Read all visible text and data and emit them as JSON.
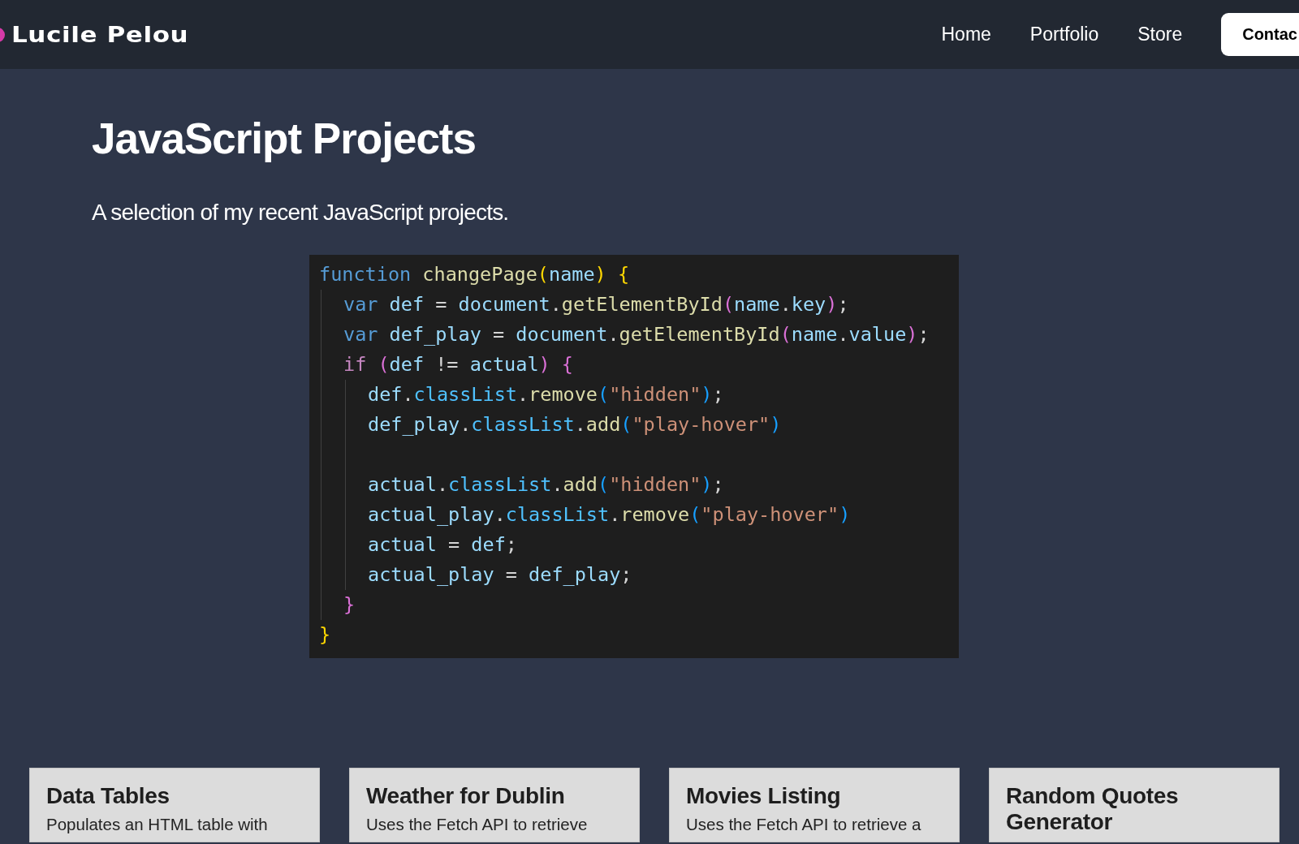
{
  "header": {
    "logo": "Lucile Pelou",
    "nav": [
      {
        "label": "Home",
        "kind": "link"
      },
      {
        "label": "Portfolio",
        "kind": "link"
      },
      {
        "label": "Store",
        "kind": "link"
      },
      {
        "label": "Contac",
        "kind": "button"
      }
    ]
  },
  "title": "JavaScript Projects",
  "subtitle": "A selection of my recent JavaScript projects.",
  "code": {
    "lines": [
      {
        "tokens": [
          {
            "text": "function ",
            "kind": "keyword"
          },
          {
            "text": "changePage",
            "kind": "function"
          },
          {
            "text": "(",
            "kind": "bracket1"
          },
          {
            "text": "name",
            "kind": "variable"
          },
          {
            "text": ")",
            "kind": "bracket1"
          },
          {
            "text": " {",
            "kind": "bracket1"
          }
        ],
        "children": [
          {
            "tokens": [
              {
                "text": "var ",
                "kind": "keyword"
              },
              {
                "text": "def",
                "kind": "variable"
              },
              {
                "text": " = ",
                "kind": "plain"
              },
              {
                "text": "document",
                "kind": "variable"
              },
              {
                "text": ".",
                "kind": "plain"
              },
              {
                "text": "getElementById",
                "kind": "function"
              },
              {
                "text": "(",
                "kind": "bracket2"
              },
              {
                "text": "name",
                "kind": "variable"
              },
              {
                "text": ".",
                "kind": "plain"
              },
              {
                "text": "key",
                "kind": "variable"
              },
              {
                "text": ")",
                "kind": "bracket2"
              },
              {
                "text": ";",
                "kind": "plain"
              }
            ]
          },
          {
            "tokens": [
              {
                "text": "var ",
                "kind": "keyword"
              },
              {
                "text": "def_play",
                "kind": "variable"
              },
              {
                "text": " = ",
                "kind": "plain"
              },
              {
                "text": "document",
                "kind": "variable"
              },
              {
                "text": ".",
                "kind": "plain"
              },
              {
                "text": "getElementById",
                "kind": "function"
              },
              {
                "text": "(",
                "kind": "bracket2"
              },
              {
                "text": "name",
                "kind": "variable"
              },
              {
                "text": ".",
                "kind": "plain"
              },
              {
                "text": "value",
                "kind": "variable"
              },
              {
                "text": ")",
                "kind": "bracket2"
              },
              {
                "text": ";",
                "kind": "plain"
              }
            ]
          },
          {
            "tokens": [
              {
                "text": "if ",
                "kind": "control"
              },
              {
                "text": "(",
                "kind": "bracket2"
              },
              {
                "text": "def",
                "kind": "variable"
              },
              {
                "text": " != ",
                "kind": "plain"
              },
              {
                "text": "actual",
                "kind": "variable"
              },
              {
                "text": ")",
                "kind": "bracket2"
              },
              {
                "text": " {",
                "kind": "bracket2"
              }
            ],
            "children": [
              {
                "kind": "code",
                "tokens": [
                  {
                    "text": "def",
                    "kind": "variable"
                  },
                  {
                    "text": ".",
                    "kind": "plain"
                  },
                  {
                    "text": "classList",
                    "kind": "property"
                  },
                  {
                    "text": ".",
                    "kind": "plain"
                  },
                  {
                    "text": "remove",
                    "kind": "function"
                  },
                  {
                    "text": "(",
                    "kind": "bracket3"
                  },
                  {
                    "text": "\"hidden\"",
                    "kind": "string"
                  },
                  {
                    "text": ")",
                    "kind": "bracket3"
                  },
                  {
                    "text": ";",
                    "kind": "plain"
                  }
                ]
              },
              {
                "kind": "code",
                "tokens": [
                  {
                    "text": "def_play",
                    "kind": "variable"
                  },
                  {
                    "text": ".",
                    "kind": "plain"
                  },
                  {
                    "text": "classList",
                    "kind": "property"
                  },
                  {
                    "text": ".",
                    "kind": "plain"
                  },
                  {
                    "text": "add",
                    "kind": "function"
                  },
                  {
                    "text": "(",
                    "kind": "bracket3"
                  },
                  {
                    "text": "\"play-hover\"",
                    "kind": "string"
                  },
                  {
                    "text": ")",
                    "kind": "bracket3"
                  }
                ]
              },
              {
                "kind": "blank"
              },
              {
                "kind": "code",
                "tokens": [
                  {
                    "text": "actual",
                    "kind": "variable"
                  },
                  {
                    "text": ".",
                    "kind": "plain"
                  },
                  {
                    "text": "classList",
                    "kind": "property"
                  },
                  {
                    "text": ".",
                    "kind": "plain"
                  },
                  {
                    "text": "add",
                    "kind": "function"
                  },
                  {
                    "text": "(",
                    "kind": "bracket3"
                  },
                  {
                    "text": "\"hidden\"",
                    "kind": "string"
                  },
                  {
                    "text": ")",
                    "kind": "bracket3"
                  },
                  {
                    "text": ";",
                    "kind": "plain"
                  }
                ]
              },
              {
                "kind": "code",
                "tokens": [
                  {
                    "text": "actual_play",
                    "kind": "variable"
                  },
                  {
                    "text": ".",
                    "kind": "plain"
                  },
                  {
                    "text": "classList",
                    "kind": "property"
                  },
                  {
                    "text": ".",
                    "kind": "plain"
                  },
                  {
                    "text": "remove",
                    "kind": "function"
                  },
                  {
                    "text": "(",
                    "kind": "bracket3"
                  },
                  {
                    "text": "\"play-hover\"",
                    "kind": "string"
                  },
                  {
                    "text": ")",
                    "kind": "bracket3"
                  }
                ]
              },
              {
                "kind": "code",
                "tokens": [
                  {
                    "text": "actual",
                    "kind": "variable"
                  },
                  {
                    "text": " = ",
                    "kind": "plain"
                  },
                  {
                    "text": "def",
                    "kind": "variable"
                  },
                  {
                    "text": ";",
                    "kind": "plain"
                  }
                ]
              },
              {
                "kind": "code",
                "tokens": [
                  {
                    "text": "actual_play",
                    "kind": "variable"
                  },
                  {
                    "text": " = ",
                    "kind": "plain"
                  },
                  {
                    "text": "def_play",
                    "kind": "variable"
                  },
                  {
                    "text": ";",
                    "kind": "plain"
                  }
                ]
              }
            ]
          },
          {
            "tokens": [
              {
                "text": "}",
                "kind": "bracket2"
              }
            ]
          }
        ]
      },
      {
        "tokens": [
          {
            "text": "}",
            "kind": "bracket1"
          }
        ]
      }
    ]
  },
  "cards": [
    {
      "title": "Data Tables",
      "description": "Populates an HTML table with"
    },
    {
      "title": "Weather for Dublin",
      "description": "Uses the Fetch API to retrieve"
    },
    {
      "title": "Movies Listing",
      "description": "Uses the Fetch API to retrieve a"
    },
    {
      "title": "Random Quotes Generator"
    }
  ]
}
